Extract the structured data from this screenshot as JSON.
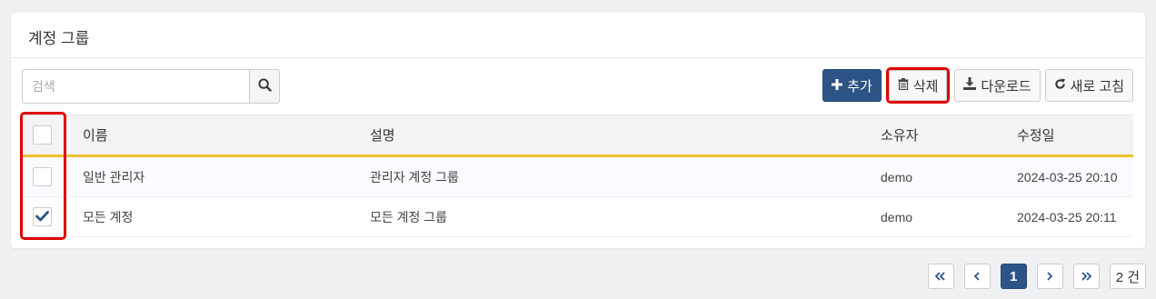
{
  "panel": {
    "title": "계정 그룹"
  },
  "search": {
    "placeholder": "검색",
    "value": ""
  },
  "buttons": {
    "add": "추가",
    "delete": "삭제",
    "download": "다운로드",
    "refresh": "새로 고침"
  },
  "table": {
    "headers": {
      "name": "이름",
      "description": "설명",
      "owner": "소유자",
      "modified": "수정일"
    },
    "rows": [
      {
        "name": "일반 관리자",
        "description": "관리자 계정 그룹",
        "owner": "demo",
        "modified": "2024-03-25 20:10",
        "checked": false
      },
      {
        "name": "모든 계정",
        "description": "모든 계정 그룹",
        "owner": "demo",
        "modified": "2024-03-25 20:11",
        "checked": true
      }
    ]
  },
  "pagination": {
    "current_page": "1",
    "total": "2 건"
  },
  "colors": {
    "primary": "#2d5487",
    "highlight": "#e00000",
    "header_accent": "#f0c030"
  }
}
